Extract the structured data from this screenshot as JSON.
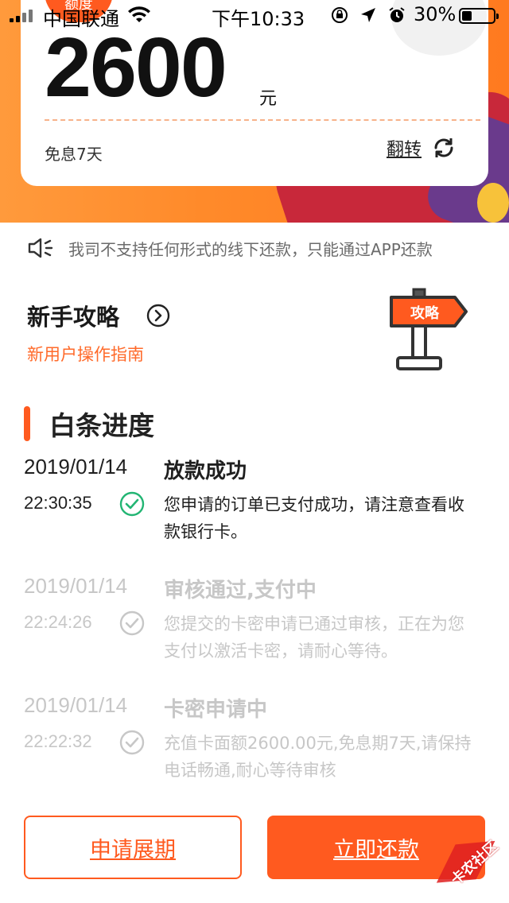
{
  "status_bar": {
    "carrier": "中国联通",
    "time": "下午10:33",
    "battery": "30%"
  },
  "card": {
    "tag": "额度",
    "amount": "2600",
    "unit": "元",
    "interest_free": "免息7天",
    "flip_label": "翻转"
  },
  "notice": {
    "text": "我司不支持任何形式的线下还款，只能通过APP还款"
  },
  "guide": {
    "title": "新手攻略",
    "subtitle": "新用户操作指南",
    "sign_text": "攻略"
  },
  "progress": {
    "title": "白条进度",
    "items": [
      {
        "date": "2019/01/14",
        "time": "22:30:35",
        "status": "放款成功",
        "desc": "您申请的订单已支付成功，请注意查看收款银行卡。",
        "state": "active"
      },
      {
        "date": "2019/01/14",
        "time": "22:24:26",
        "status": "审核通过,支付中",
        "desc": "您提交的卡密申请已通过审核，正在为您支付以激活卡密，请耐心等待。",
        "state": "done"
      },
      {
        "date": "2019/01/14",
        "time": "22:22:32",
        "status": "卡密申请中",
        "desc": "充值卡面额2600.00元,免息期7天,请保持电话畅通,耐心等待审核",
        "state": "done"
      }
    ]
  },
  "buttons": {
    "extend": "申请展期",
    "repay": "立即还款"
  },
  "watermark": "卡农社区",
  "colors": {
    "accent": "#ff5a1f",
    "hero_orange": "#ff8a2a",
    "success_green": "#22b573",
    "muted": "#c7c7c7"
  }
}
